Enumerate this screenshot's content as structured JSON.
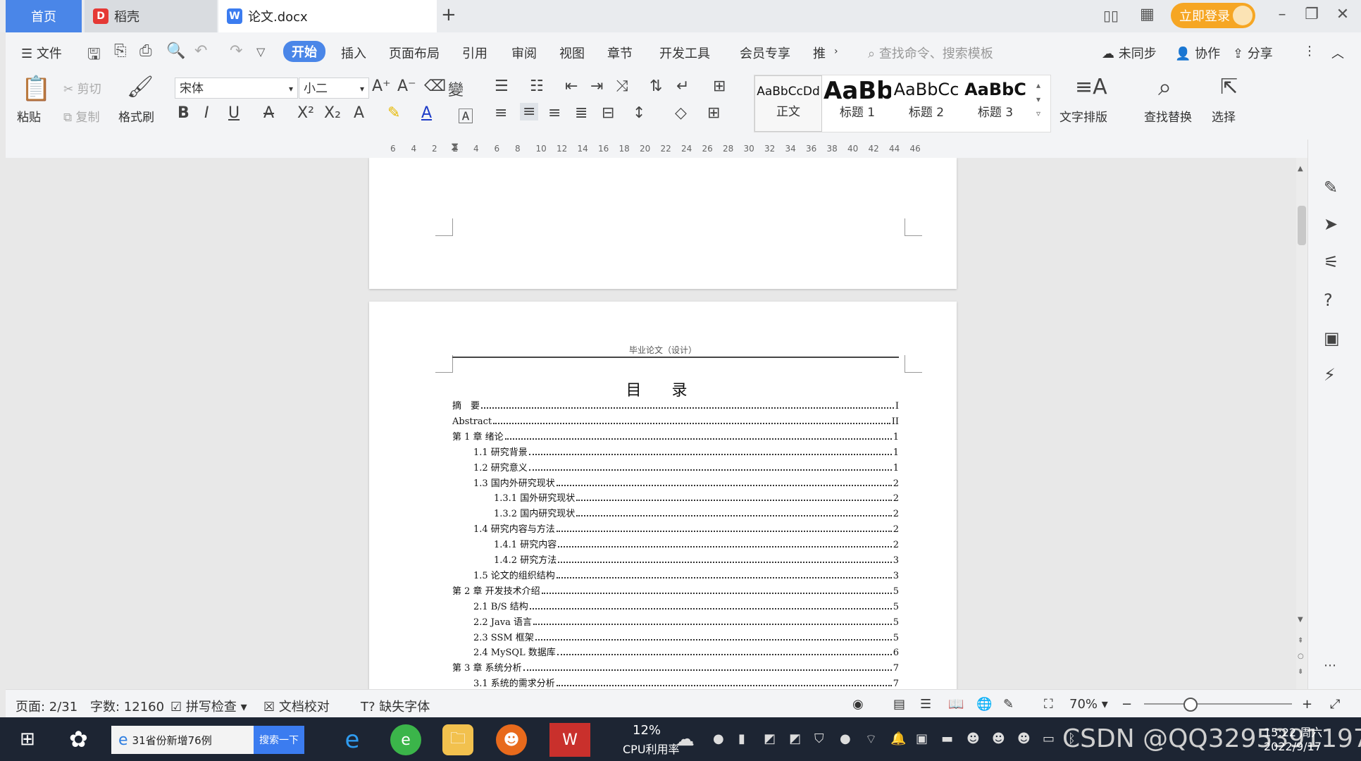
{
  "tabs": {
    "home": "首页",
    "daoke": "稻壳",
    "document": "论文.docx",
    "add": "+"
  },
  "titlebar": {
    "login": "立即登录"
  },
  "menu": {
    "file": "文件",
    "items": [
      "开始",
      "插入",
      "页面布局",
      "引用",
      "审阅",
      "视图",
      "章节",
      "开发工具",
      "会员专享",
      "推"
    ],
    "search_placeholder": "查找命令、搜索模板",
    "sync": "未同步",
    "collab": "协作",
    "share": "分享"
  },
  "ribbon": {
    "paste": "粘贴",
    "cut": "剪切",
    "copy": "复制",
    "format_painter": "格式刷",
    "font_name": "宋体",
    "font_size": "小二",
    "styles": [
      {
        "preview": "AaBbCcDd",
        "label": "正文"
      },
      {
        "preview": "AaBb",
        "label": "标题 1"
      },
      {
        "preview": "AaBbCc",
        "label": "标题 2"
      },
      {
        "preview": "AaBbC",
        "label": "标题 3"
      }
    ],
    "text_layout": "文字排版",
    "find_replace": "查找替换",
    "select": "选择"
  },
  "ruler": {
    "ticks": [
      "6",
      "4",
      "2",
      "2",
      "4",
      "6",
      "8",
      "10",
      "12",
      "14",
      "16",
      "18",
      "20",
      "22",
      "24",
      "26",
      "28",
      "30",
      "32",
      "34",
      "36",
      "38",
      "40",
      "42",
      "44",
      "46"
    ]
  },
  "document": {
    "header": "毕业论文（设计）",
    "toc_title": "目 录",
    "toc": [
      {
        "label": "摘　要",
        "page": "I",
        "level": 1
      },
      {
        "label": "Abstract",
        "page": "II",
        "level": 1
      },
      {
        "label": "第 1 章  绪论",
        "page": "1",
        "level": 1
      },
      {
        "label": "1.1 研究背景",
        "page": "1",
        "level": 2
      },
      {
        "label": "1.2 研究意义",
        "page": "1",
        "level": 2
      },
      {
        "label": "1.3 国内外研究现状",
        "page": "2",
        "level": 2
      },
      {
        "label": "1.3.1 国外研究现状",
        "page": "2",
        "level": 3
      },
      {
        "label": "1.3.2 国内研究现状",
        "page": "2",
        "level": 3
      },
      {
        "label": "1.4 研究内容与方法",
        "page": "2",
        "level": 2
      },
      {
        "label": "1.4.1 研究内容",
        "page": "2",
        "level": 3
      },
      {
        "label": "1.4.2 研究方法",
        "page": "3",
        "level": 3
      },
      {
        "label": "1.5 论文的组织结构",
        "page": "3",
        "level": 2
      },
      {
        "label": "第 2 章  开发技术介绍",
        "page": "5",
        "level": 1
      },
      {
        "label": "2.1 B/S 结构",
        "page": "5",
        "level": 2
      },
      {
        "label": "2.2 Java 语言",
        "page": "5",
        "level": 2
      },
      {
        "label": "2.3 SSM 框架",
        "page": "5",
        "level": 2
      },
      {
        "label": "2.4 MySQL 数据库",
        "page": "6",
        "level": 2
      },
      {
        "label": "第 3 章  系统分析",
        "page": "7",
        "level": 1
      },
      {
        "label": "3.1 系统的需求分析",
        "page": "7",
        "level": 2
      }
    ]
  },
  "status": {
    "page": "页面: 2/31",
    "words": "字数: 12160",
    "spell": "拼写检查",
    "proof": "文档校对",
    "missing_font": "缺失字体",
    "zoom": "70%"
  },
  "taskbar": {
    "search_text": "31省份新增76例",
    "search_button": "搜索一下",
    "cpu_value": "12%",
    "cpu_label": "CPU利用率",
    "watermark": "CSDN @QQ3295391197",
    "time": "15:22 周六",
    "date": "2022/9/17"
  },
  "colors": {
    "accent": "#4a86e8",
    "login": "#f6a623",
    "taskbar": "#1d2533"
  }
}
